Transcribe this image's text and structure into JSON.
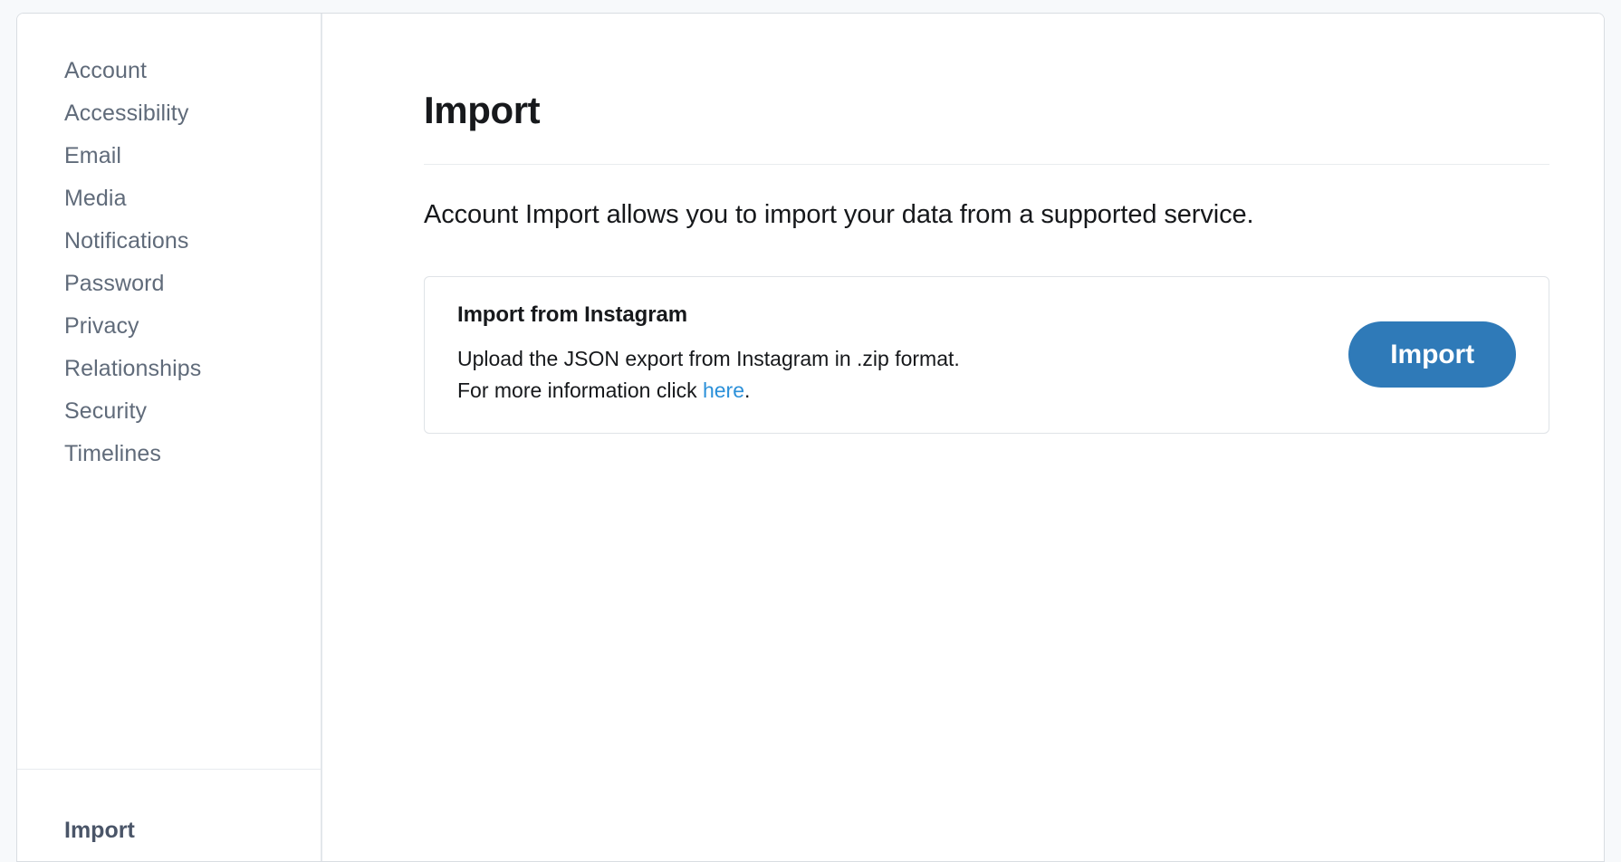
{
  "sidebar": {
    "items": [
      {
        "label": "Account"
      },
      {
        "label": "Accessibility"
      },
      {
        "label": "Email"
      },
      {
        "label": "Media"
      },
      {
        "label": "Notifications"
      },
      {
        "label": "Password"
      },
      {
        "label": "Privacy"
      },
      {
        "label": "Relationships"
      },
      {
        "label": "Security"
      },
      {
        "label": "Timelines"
      }
    ],
    "footer_item": {
      "label": "Import",
      "active": true
    }
  },
  "main": {
    "page_title": "Import",
    "description": "Account Import allows you to import your data from a supported service.",
    "card": {
      "title": "Import from Instagram",
      "line1": "Upload the JSON export from Instagram in .zip format.",
      "line2_prefix": "For more information click ",
      "line2_link": "here",
      "line2_suffix": ".",
      "button_label": "Import"
    }
  },
  "colors": {
    "accent": "#2f7ab8",
    "link": "#2b90d9",
    "text": "#16181b",
    "muted": "#606b7a",
    "border": "#dfe3e7"
  }
}
